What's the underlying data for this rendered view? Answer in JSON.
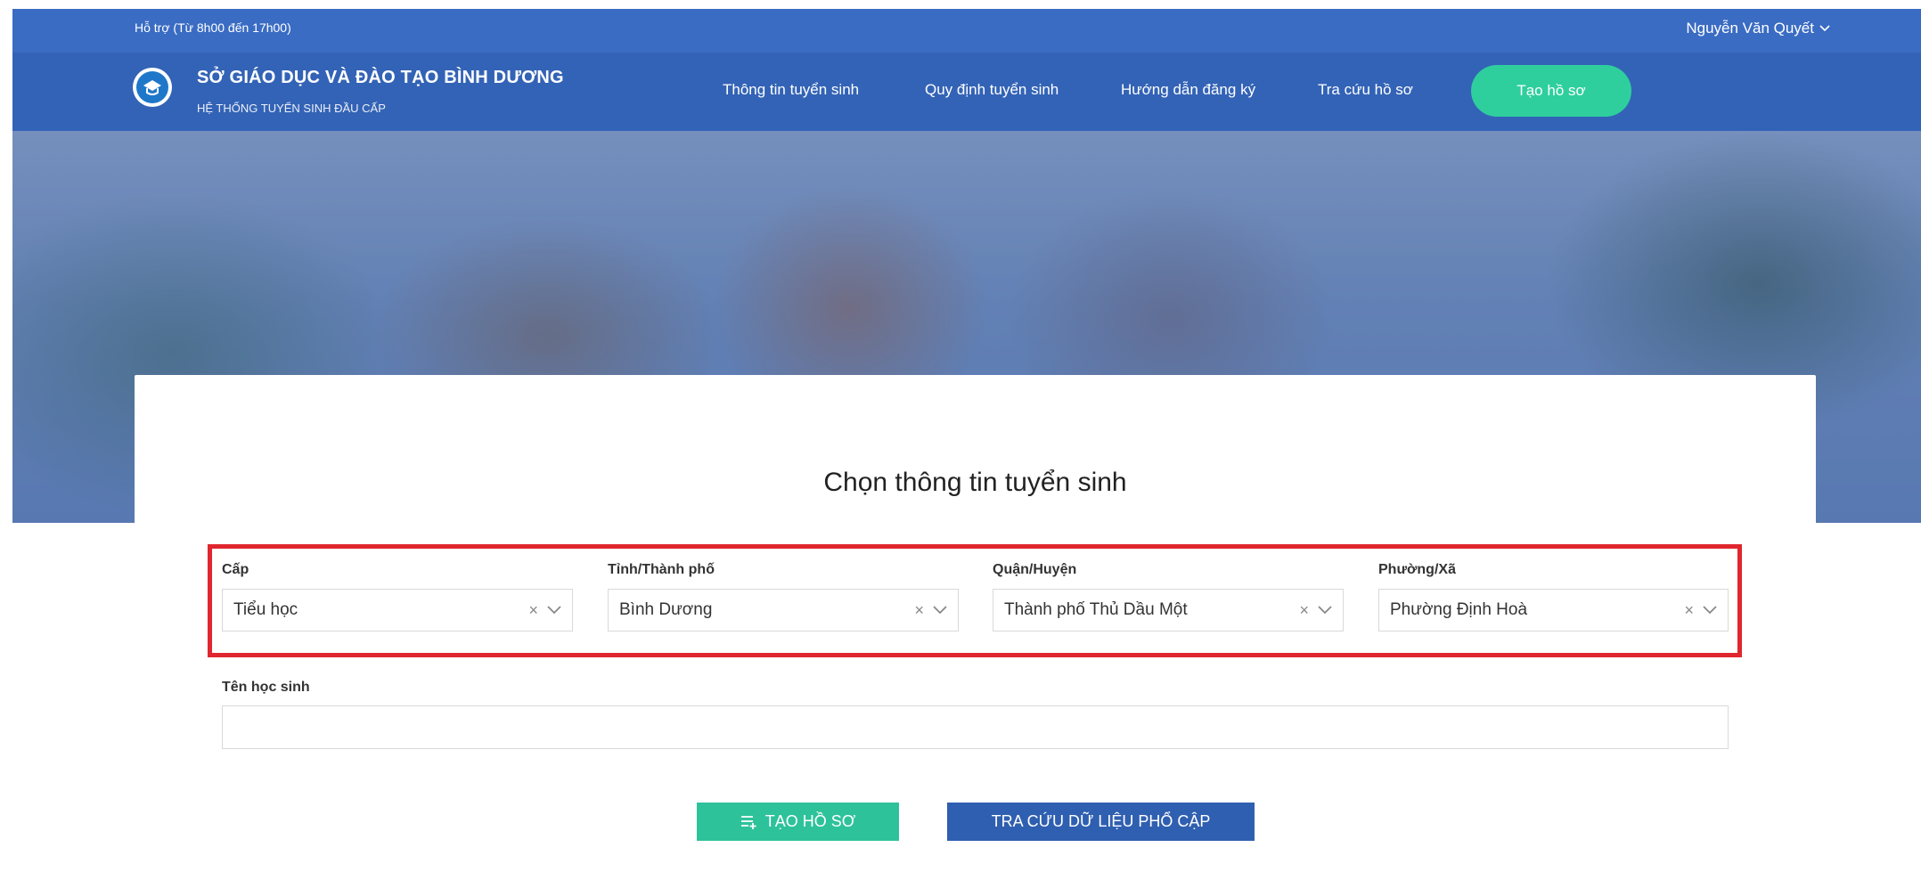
{
  "topbar": {
    "support_text": "Hỗ trợ (Từ 8h00 đến 17h00)",
    "user_name": "Nguyễn Văn Quyết"
  },
  "brand": {
    "title": "SỞ GIÁO DỤC VÀ ĐÀO TẠO BÌNH DƯƠNG",
    "subtitle": "HỆ THỐNG TUYỂN SINH ĐẦU CẤP"
  },
  "nav": {
    "items": [
      "Thông tin tuyển sinh",
      "Quy định tuyển sinh",
      "Hướng dẫn đăng ký",
      "Tra cứu hồ sơ"
    ],
    "cta": "Tạo hồ sơ"
  },
  "form": {
    "title": "Chọn thông tin tuyển sinh",
    "fields": [
      {
        "label": "Cấp",
        "value": "Tiểu học"
      },
      {
        "label": "Tỉnh/Thành phố",
        "value": "Bình Dương"
      },
      {
        "label": "Quận/Huyện",
        "value": "Thành phố Thủ Dầu Một"
      },
      {
        "label": "Phường/Xã",
        "value": "Phường Định Hoà"
      }
    ],
    "student_name_label": "Tên học sinh",
    "student_name_value": "",
    "create_button": "TẠO HỒ SƠ",
    "lookup_button": "TRA CỨU DỮ LIỆU PHỔ CẬP"
  },
  "colors": {
    "topbar": "#3a6cc3",
    "navbar": "#3363b6",
    "accent_green": "#2ecf9d",
    "button_blue": "#2f5fb0",
    "highlight_red": "#e0262e"
  },
  "icons": {
    "logo": "school-emblem-icon",
    "user_dropdown": "chevron-down-icon",
    "clear": "clear-x-icon",
    "dropdown": "chevron-down-icon",
    "create": "list-add-icon"
  }
}
